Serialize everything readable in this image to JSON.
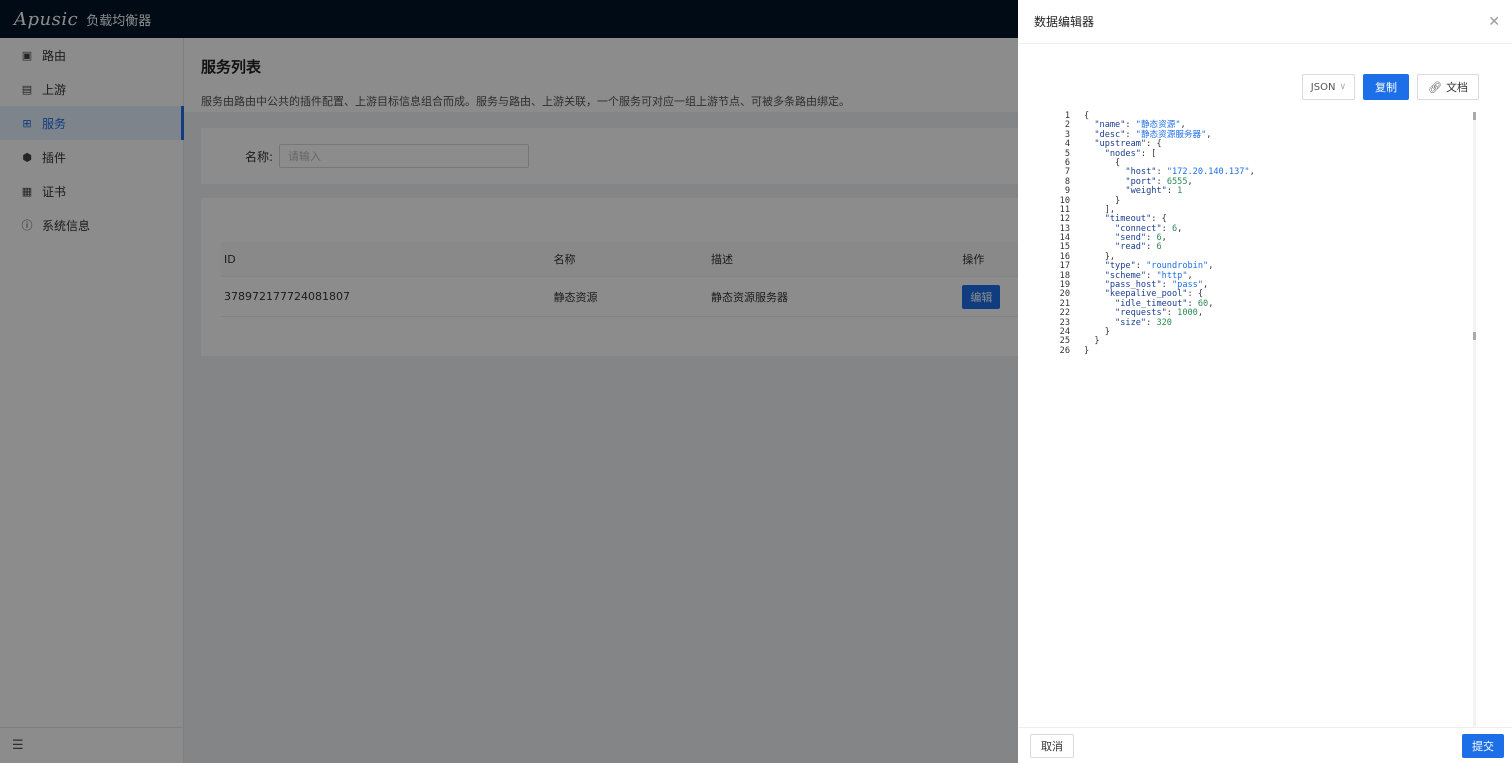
{
  "app": {
    "logo": "Apusic",
    "subtitle": "负载均衡器"
  },
  "sidebar": {
    "items": [
      {
        "label": "路由",
        "icon": "route-icon"
      },
      {
        "label": "上游",
        "icon": "upstream-icon"
      },
      {
        "label": "服务",
        "icon": "service-icon",
        "active": true
      },
      {
        "label": "插件",
        "icon": "plugin-icon"
      },
      {
        "label": "证书",
        "icon": "certificate-icon"
      },
      {
        "label": "系统信息",
        "icon": "info-icon"
      }
    ],
    "footer_icon": "collapse-menu-icon"
  },
  "page": {
    "title": "服务列表",
    "description": "服务由路由中公共的插件配置、上游目标信息组合而成。服务与路由、上游关联，一个服务可对应一组上游节点、可被多条路由绑定。"
  },
  "search": {
    "label": "名称:",
    "placeholder": "请输入"
  },
  "table": {
    "headers": [
      "ID",
      "名称",
      "描述",
      "操作"
    ],
    "rows": [
      {
        "id": "378972177724081807",
        "name": "静态资源",
        "desc": "静态资源服务器",
        "action": "编辑"
      }
    ]
  },
  "drawer": {
    "title": "数据编辑器",
    "format": "JSON",
    "copy_label": "复制",
    "docs_label": "文档",
    "cancel_label": "取消",
    "submit_label": "提交"
  },
  "editor": {
    "lines": [
      "{",
      "  \"name\": \"静态资源\",",
      "  \"desc\": \"静态资源服务器\",",
      "  \"upstream\": {",
      "    \"nodes\": [",
      "      {",
      "        \"host\": \"172.20.140.137\",",
      "        \"port\": 6555,",
      "        \"weight\": 1",
      "      }",
      "    ],",
      "    \"timeout\": {",
      "      \"connect\": 6,",
      "      \"send\": 6,",
      "      \"read\": 6",
      "    },",
      "    \"type\": \"roundrobin\",",
      "    \"scheme\": \"http\",",
      "    \"pass_host\": \"pass\",",
      "    \"keepalive_pool\": {",
      "      \"idle_timeout\": 60,",
      "      \"requests\": 1000,",
      "      \"size\": 320",
      "    }",
      "  }",
      "}"
    ]
  }
}
